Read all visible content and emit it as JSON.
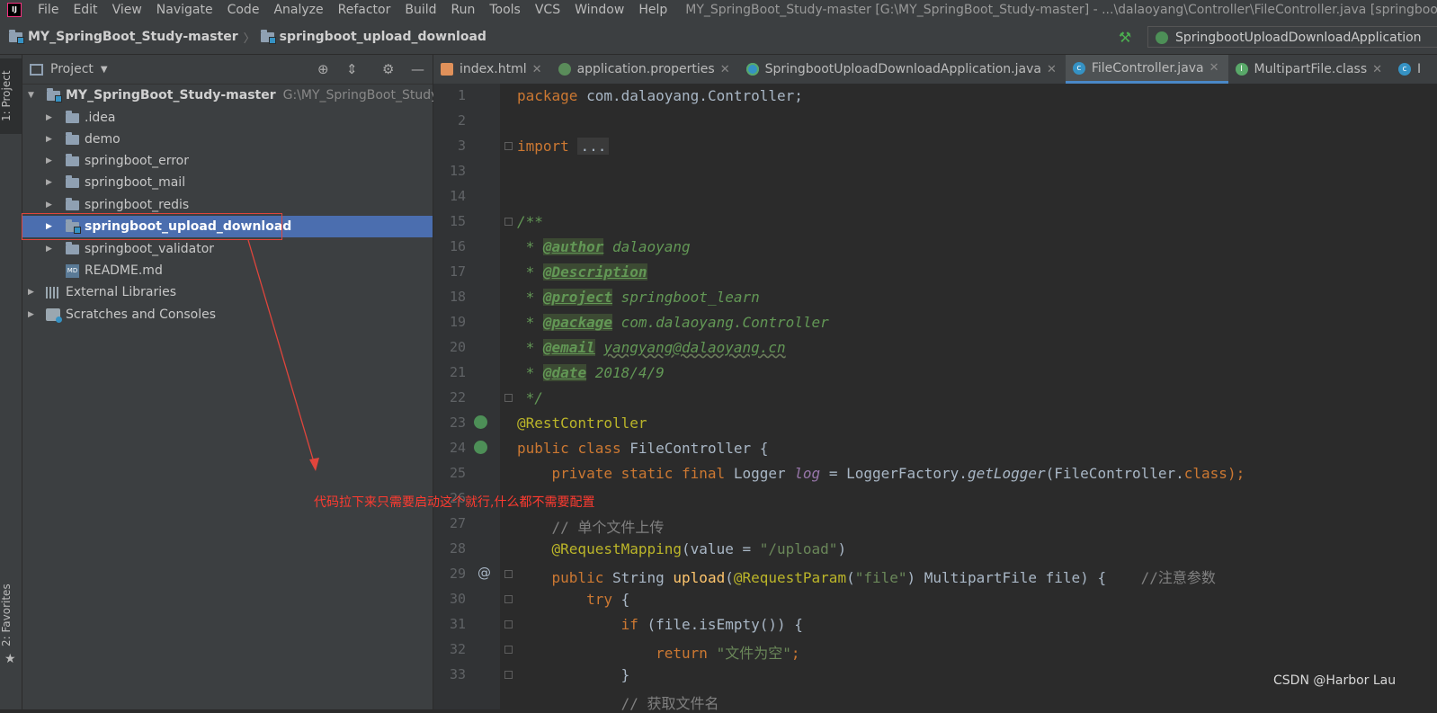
{
  "menubar": {
    "logo": "IJ",
    "items": [
      "File",
      "Edit",
      "View",
      "Navigate",
      "Code",
      "Analyze",
      "Refactor",
      "Build",
      "Run",
      "Tools",
      "VCS",
      "Window",
      "Help"
    ],
    "window_title": "MY_SpringBoot_Study-master [G:\\MY_SpringBoot_Study-master] - ...\\dalaoyang\\Controller\\FileController.java [springboot_upload_download]"
  },
  "navbar": {
    "breadcrumbs": [
      "MY_SpringBoot_Study-master",
      "springboot_upload_download"
    ],
    "run_config": "SpringbootUploadDownloadApplication"
  },
  "left_strip": {
    "project_tab": "1: Project",
    "favorites_tab": "2: Favorites"
  },
  "project_panel": {
    "title": "Project",
    "root": {
      "name": "MY_SpringBoot_Study-master",
      "path": "G:\\MY_SpringBoot_Study-master"
    },
    "items": [
      ".idea",
      "demo",
      "springboot_error",
      "springboot_mail",
      "springboot_redis",
      "springboot_upload_download",
      "springboot_validator",
      "README.md",
      "External Libraries",
      "Scratches and Consoles"
    ],
    "selected": "springboot_upload_download",
    "md_icon": "MD"
  },
  "editor_tabs": [
    "index.html",
    "application.properties",
    "SpringbootUploadDownloadApplication.java",
    "FileController.java",
    "MultipartFile.class",
    "I"
  ],
  "active_tab": "FileController.java",
  "code": {
    "line_numbers": [
      "1",
      "2",
      "3",
      "13",
      "14",
      "15",
      "16",
      "17",
      "18",
      "19",
      "20",
      "21",
      "22",
      "23",
      "24",
      "25",
      "26",
      "27",
      "28",
      "29",
      "30",
      "31",
      "32",
      "33"
    ],
    "package_kw": "package",
    "package_name": "com.dalaoyang.Controller;",
    "import_kw": "import",
    "import_folded": "...",
    "doc_open": "/**",
    "star": " * ",
    "author_tag": "@author",
    "author_val": "dalaoyang",
    "description_tag": "@Description",
    "project_tag": "@project",
    "project_val": "springboot_learn",
    "package_tag": "@package",
    "package_val": "com.dalaoyang.Controller",
    "email_tag": "@email",
    "email_val": "yangyang@dalaoyang.cn",
    "date_tag": "@date",
    "date_val": "2018/4/9",
    "doc_close": " */",
    "rest_controller": "@RestController",
    "class_public": "public",
    "class_kw": "class",
    "class_decl": "FileController {",
    "l25_mods": "private static final",
    "l25_type": "Logger",
    "l25_field": "log",
    "l25_eq": "= LoggerFactory.",
    "l25_method": "getLogger",
    "l25_args": "(FileController.",
    "l25_classkw": "class",
    "l25_end": ");",
    "l27_comment": "// 单个文件上传",
    "l28_ann": "@RequestMapping",
    "l28_param": "(value = ",
    "l28_str": "\"/upload\"",
    "l28_end": ")",
    "l29_public": "public",
    "l29_type": "String",
    "l29_method": "upload",
    "l29_open": "(",
    "l29_ann": "@RequestParam",
    "l29_paren": "(",
    "l29_str": "\"file\"",
    "l29_args": ") MultipartFile file) {",
    "l29_comment": "//注意参数",
    "l30_try": "try",
    "l30_brace": "{",
    "l31_if": "if",
    "l31_cond": "(file.isEmpty()) {",
    "l32_return": "return",
    "l32_str": "\"文件为空\"",
    "l32_end": ";",
    "l33": "}",
    "l34_partial": "// 获取文件名"
  },
  "annotation_text": "代码拉下来只需要启动这个就行,什么都不需要配置",
  "watermark": "CSDN @Harbor Lau",
  "colors": {
    "selection": "#4b6eaf",
    "annotation_red": "#ff3b30",
    "keyword": "#cc7832",
    "string": "#6a8759",
    "doc_comment": "#629755"
  }
}
